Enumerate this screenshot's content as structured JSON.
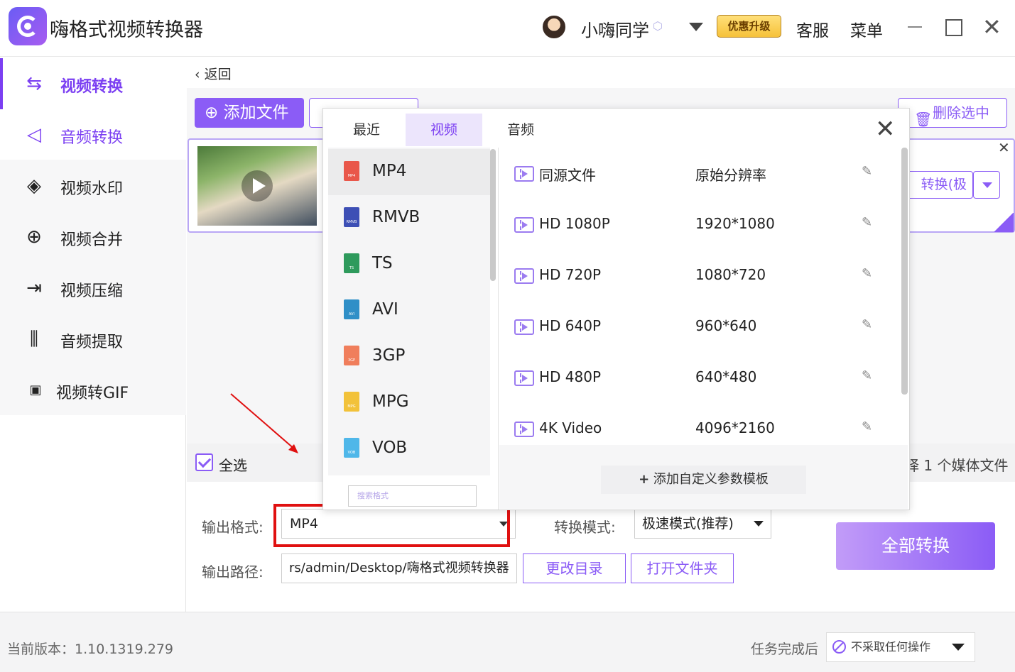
{
  "app": {
    "title": "嗨格式视频转换器",
    "user_name": "小嗨同学",
    "upgrade_label": "优惠升级",
    "service_label": "客服",
    "menu_label": "菜单"
  },
  "sidebar": {
    "items": [
      {
        "label": "视频转换",
        "icon": "video-convert-icon"
      },
      {
        "label": "音频转换",
        "icon": "audio-convert-icon"
      },
      {
        "label": "视频水印",
        "icon": "watermark-icon"
      },
      {
        "label": "视频合并",
        "icon": "merge-icon"
      },
      {
        "label": "视频压缩",
        "icon": "compress-icon"
      },
      {
        "label": "音频提取",
        "icon": "audio-extract-icon"
      },
      {
        "label": "视频转GIF",
        "icon": "gif-icon"
      }
    ]
  },
  "main": {
    "back_label": "返回",
    "add_file_label": "添加文件",
    "delete_selected_label": "删除选中",
    "convert_button_label": "转换(极速)",
    "select_all_label": "全选",
    "count_text": "择 1 个媒体文件",
    "output_format_label": "输出格式:",
    "output_format_value": "MP4",
    "convert_mode_label": "转换模式:",
    "convert_mode_value": "极速模式(推荐)",
    "output_path_label": "输出路径:",
    "output_path_value": "rs/admin/Desktop/嗨格式视频转换器",
    "change_dir_label": "更改目录",
    "open_folder_label": "打开文件夹",
    "convert_all_label": "全部转换"
  },
  "statusbar": {
    "version": "当前版本：1.10.1319.279",
    "after_task_label": "任务完成后",
    "after_task_value": "不采取任何操作"
  },
  "popup": {
    "tabs": [
      {
        "label": "最近"
      },
      {
        "label": "视频"
      },
      {
        "label": "音频"
      }
    ],
    "formats": [
      {
        "label": "MP4",
        "tag": "MP4",
        "color": "#e9574a"
      },
      {
        "label": "RMVB",
        "tag": "RMVB",
        "color": "#3d4fb5"
      },
      {
        "label": "TS",
        "tag": "TS",
        "color": "#2e9a5c"
      },
      {
        "label": "AVI",
        "tag": "AVI",
        "color": "#2f8fc7"
      },
      {
        "label": "3GP",
        "tag": "3GP",
        "color": "#f07e5c"
      },
      {
        "label": "MPG",
        "tag": "MPG",
        "color": "#f2c23a"
      },
      {
        "label": "VOB",
        "tag": "VOB",
        "color": "#4fb7e9"
      }
    ],
    "search_placeholder": "搜索格式",
    "presets": [
      {
        "name": "同源文件",
        "resolution": "原始分辨率"
      },
      {
        "name": "HD 1080P",
        "resolution": "1920*1080"
      },
      {
        "name": "HD 720P",
        "resolution": "1080*720"
      },
      {
        "name": "HD 640P",
        "resolution": "960*640"
      },
      {
        "name": "HD 480P",
        "resolution": "640*480"
      },
      {
        "name": "4K Video",
        "resolution": "4096*2160"
      }
    ],
    "add_template_label": "添加自定义参数模板"
  },
  "colors": {
    "accent": "#8b5cf6",
    "annotation": "#e01010"
  }
}
